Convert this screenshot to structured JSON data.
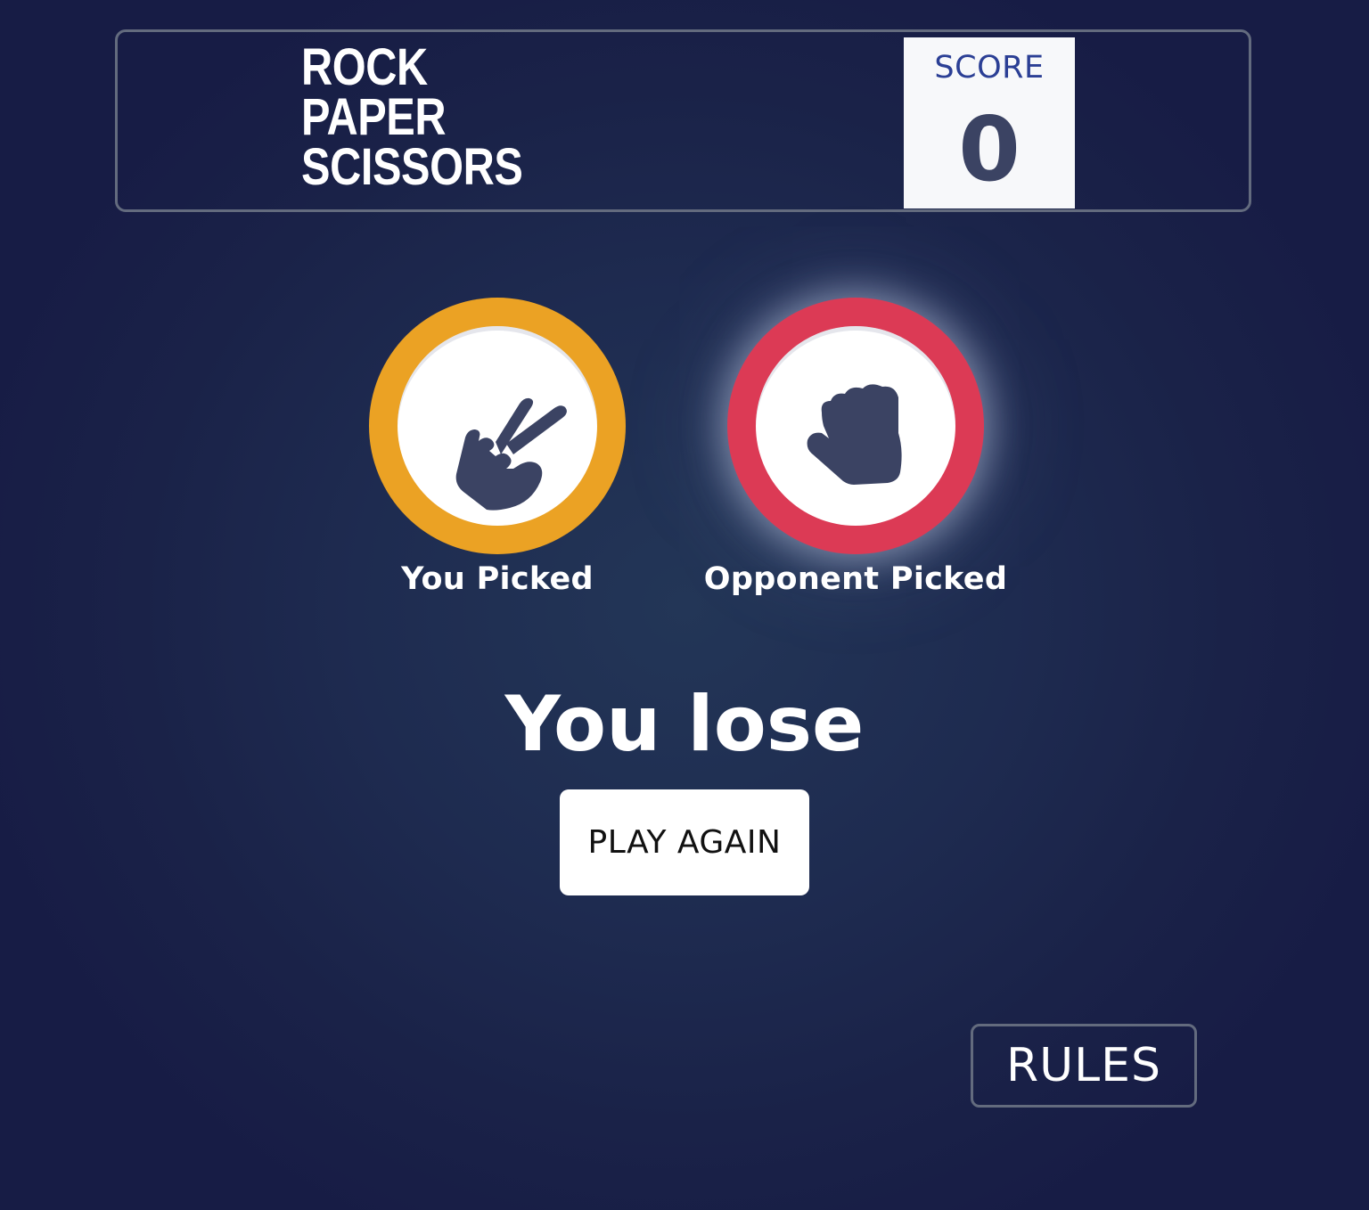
{
  "header": {
    "title_lines": [
      "ROCK",
      "PAPER",
      "SCISSORS"
    ],
    "score_label": "SCORE",
    "score_value": "0"
  },
  "picks": {
    "you": {
      "label": "You Picked",
      "choice_icon": "scissors-icon",
      "ring_color": "#eba224"
    },
    "opponent": {
      "label": "Opponent Picked",
      "choice_icon": "rock-icon",
      "ring_color": "#dc3a55"
    }
  },
  "result": {
    "text": "You lose",
    "play_again_label": "PLAY AGAIN"
  },
  "footer": {
    "rules_label": "RULES"
  },
  "colors": {
    "background": "#1e2b50",
    "icon": "#3b4363",
    "score_label": "#2b3f95"
  }
}
